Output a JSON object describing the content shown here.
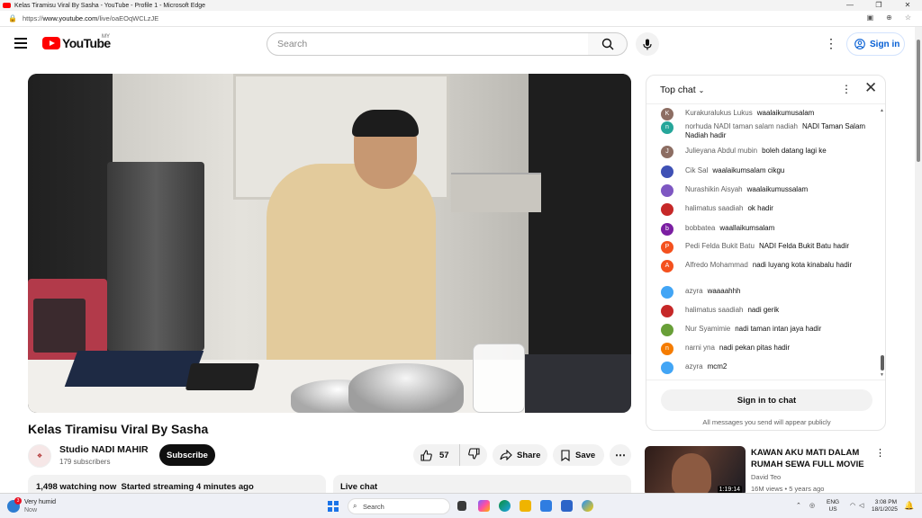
{
  "browser": {
    "window_title": "Kelas Tiramisu Viral By Sasha - YouTube - Profile 1 - Microsoft Edge",
    "url_prefix": "https://",
    "url_domain": "www.youtube.com",
    "url_path": "/live/oaEOqWCLzJE"
  },
  "header": {
    "logo_text": "YouTube",
    "country_code": "MY",
    "search_placeholder": "Search",
    "sign_in_label": "Sign in"
  },
  "video": {
    "title": "Kelas Tiramisu Viral By Sasha",
    "channel_name": "Studio NADI MAHIR",
    "subscribers": "179 subscribers",
    "subscribe_label": "Subscribe",
    "like_count": "57",
    "share_label": "Share",
    "save_label": "Save",
    "watching": "1,498 watching now",
    "started": "Started streaming 4 minutes ago",
    "live_chat_label": "Live chat"
  },
  "chat": {
    "mode_label": "Top chat",
    "messages": [
      {
        "author": "Kurakuralukus Lukus",
        "text": "waalaikumusalam",
        "initial": "K",
        "color": "#8d6e63"
      },
      {
        "author": "norhuda NADI taman salam nadiah",
        "text": "NADI Taman Salam Nadiah hadir",
        "initial": "n",
        "color": "#26a69a"
      },
      {
        "author": "Julieyana Abdul mubin",
        "text": "boleh datang lagi ke",
        "initial": "J",
        "color": "#8d6e63"
      },
      {
        "author": "Cik Sal",
        "text": "waalaikumsalam cikgu",
        "initial": "",
        "color": "#3f51b5"
      },
      {
        "author": "Nurashikin Aisyah",
        "text": "waalaikumussalam",
        "initial": "",
        "color": "#7e57c2"
      },
      {
        "author": "halimatus saadiah",
        "text": "ok hadir",
        "initial": "",
        "color": "#c62828"
      },
      {
        "author": "bobbatea",
        "text": "waallaikumsalam",
        "initial": "b",
        "color": "#7b1fa2"
      },
      {
        "author": "Pedi Felda Bukit Batu",
        "text": "NADI Felda Bukit Batu hadir",
        "initial": "P",
        "color": "#f4511e"
      },
      {
        "author": "Alfredo Mohammad",
        "text": "nadi luyang kota kinabalu hadir",
        "initial": "A",
        "color": "#f4511e"
      },
      {
        "author": "azyra",
        "text": "waaaahhh",
        "initial": "",
        "color": "#42a5f5"
      },
      {
        "author": "halimatus saadiah",
        "text": "nadi gerik",
        "initial": "",
        "color": "#c62828"
      },
      {
        "author": "Nur Syamimie",
        "text": "nadi taman intan jaya hadir",
        "initial": "",
        "color": "#689f38"
      },
      {
        "author": "narni yna",
        "text": "nadi pekan pitas hadir",
        "initial": "n",
        "color": "#f57c00"
      },
      {
        "author": "azyra",
        "text": "mcm2",
        "initial": "",
        "color": "#42a5f5"
      }
    ],
    "sign_in_label": "Sign in to chat",
    "public_note": "All messages you send will appear publicly"
  },
  "recommended": {
    "title": "KAWAN AKU MATI DALAM RUMAH SEWA FULL MOVIE",
    "channel": "David Teo",
    "meta": "16M views • 5 years ago",
    "duration": "1:19:14"
  },
  "taskbar": {
    "weather_notification_count": "3",
    "weather_line1": "Very humid",
    "weather_line2": "Now",
    "search_label": "Search",
    "lang_line1": "ENG",
    "lang_line2": "US",
    "time": "3:08 PM",
    "date": "18/1/2025"
  }
}
